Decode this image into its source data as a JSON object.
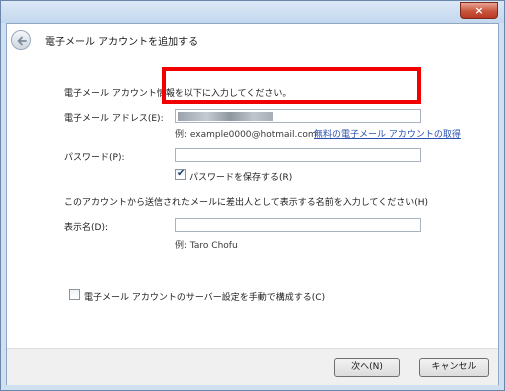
{
  "dialog": {
    "close_label": "×",
    "header_title": "電子メール アカウントを追加する"
  },
  "form": {
    "intro": "電子メール アカウント情報を以下に入力してください。",
    "email_label": "電子メール アドレス(E):",
    "email_example": "例: example0000@hotmail.com",
    "email_link": "無料の電子メール アカウントの取得",
    "password_label": "パスワード(P):",
    "remember_password_label": "パスワードを保存する(R)",
    "remember_password_checked": true,
    "display_name_instruction": "このアカウントから送信されたメールに差出人として表示する名前を入力してください(H)",
    "display_name_label": "表示名(D):",
    "display_name_example": "例: Taro Chofu",
    "manual_config_label": "電子メール アカウントのサーバー設定を手動で構成する(C)",
    "manual_config_checked": false
  },
  "buttons": {
    "next": "次へ(N)",
    "cancel": "キャンセル"
  },
  "icons": {
    "back": "back-arrow-icon",
    "close": "close-icon"
  },
  "colors": {
    "highlight": "#f00000"
  }
}
